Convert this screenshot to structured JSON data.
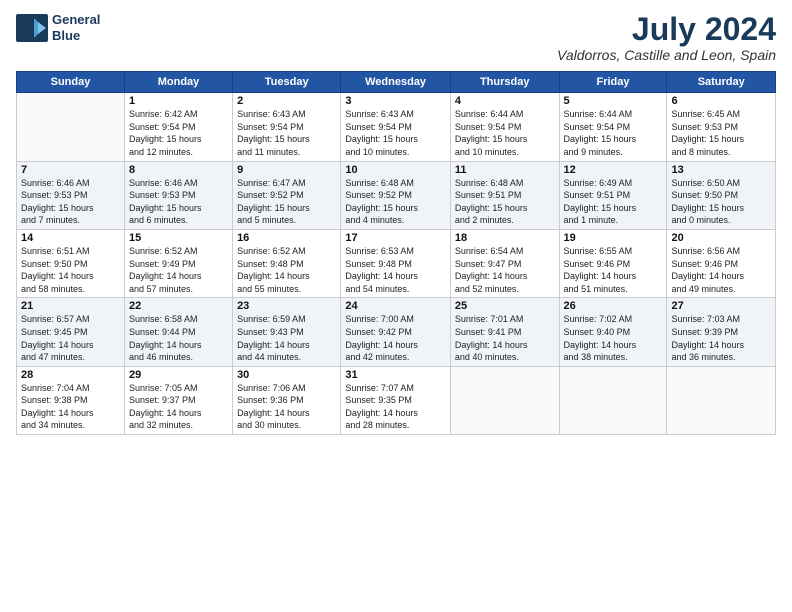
{
  "logo": {
    "line1": "General",
    "line2": "Blue"
  },
  "title": "July 2024",
  "location": "Valdorros, Castille and Leon, Spain",
  "days_of_week": [
    "Sunday",
    "Monday",
    "Tuesday",
    "Wednesday",
    "Thursday",
    "Friday",
    "Saturday"
  ],
  "weeks": [
    [
      {
        "day": "",
        "info": ""
      },
      {
        "day": "1",
        "info": "Sunrise: 6:42 AM\nSunset: 9:54 PM\nDaylight: 15 hours\nand 12 minutes."
      },
      {
        "day": "2",
        "info": "Sunrise: 6:43 AM\nSunset: 9:54 PM\nDaylight: 15 hours\nand 11 minutes."
      },
      {
        "day": "3",
        "info": "Sunrise: 6:43 AM\nSunset: 9:54 PM\nDaylight: 15 hours\nand 10 minutes."
      },
      {
        "day": "4",
        "info": "Sunrise: 6:44 AM\nSunset: 9:54 PM\nDaylight: 15 hours\nand 10 minutes."
      },
      {
        "day": "5",
        "info": "Sunrise: 6:44 AM\nSunset: 9:54 PM\nDaylight: 15 hours\nand 9 minutes."
      },
      {
        "day": "6",
        "info": "Sunrise: 6:45 AM\nSunset: 9:53 PM\nDaylight: 15 hours\nand 8 minutes."
      }
    ],
    [
      {
        "day": "7",
        "info": "Sunrise: 6:46 AM\nSunset: 9:53 PM\nDaylight: 15 hours\nand 7 minutes."
      },
      {
        "day": "8",
        "info": "Sunrise: 6:46 AM\nSunset: 9:53 PM\nDaylight: 15 hours\nand 6 minutes."
      },
      {
        "day": "9",
        "info": "Sunrise: 6:47 AM\nSunset: 9:52 PM\nDaylight: 15 hours\nand 5 minutes."
      },
      {
        "day": "10",
        "info": "Sunrise: 6:48 AM\nSunset: 9:52 PM\nDaylight: 15 hours\nand 4 minutes."
      },
      {
        "day": "11",
        "info": "Sunrise: 6:48 AM\nSunset: 9:51 PM\nDaylight: 15 hours\nand 2 minutes."
      },
      {
        "day": "12",
        "info": "Sunrise: 6:49 AM\nSunset: 9:51 PM\nDaylight: 15 hours\nand 1 minute."
      },
      {
        "day": "13",
        "info": "Sunrise: 6:50 AM\nSunset: 9:50 PM\nDaylight: 15 hours\nand 0 minutes."
      }
    ],
    [
      {
        "day": "14",
        "info": "Sunrise: 6:51 AM\nSunset: 9:50 PM\nDaylight: 14 hours\nand 58 minutes."
      },
      {
        "day": "15",
        "info": "Sunrise: 6:52 AM\nSunset: 9:49 PM\nDaylight: 14 hours\nand 57 minutes."
      },
      {
        "day": "16",
        "info": "Sunrise: 6:52 AM\nSunset: 9:48 PM\nDaylight: 14 hours\nand 55 minutes."
      },
      {
        "day": "17",
        "info": "Sunrise: 6:53 AM\nSunset: 9:48 PM\nDaylight: 14 hours\nand 54 minutes."
      },
      {
        "day": "18",
        "info": "Sunrise: 6:54 AM\nSunset: 9:47 PM\nDaylight: 14 hours\nand 52 minutes."
      },
      {
        "day": "19",
        "info": "Sunrise: 6:55 AM\nSunset: 9:46 PM\nDaylight: 14 hours\nand 51 minutes."
      },
      {
        "day": "20",
        "info": "Sunrise: 6:56 AM\nSunset: 9:46 PM\nDaylight: 14 hours\nand 49 minutes."
      }
    ],
    [
      {
        "day": "21",
        "info": "Sunrise: 6:57 AM\nSunset: 9:45 PM\nDaylight: 14 hours\nand 47 minutes."
      },
      {
        "day": "22",
        "info": "Sunrise: 6:58 AM\nSunset: 9:44 PM\nDaylight: 14 hours\nand 46 minutes."
      },
      {
        "day": "23",
        "info": "Sunrise: 6:59 AM\nSunset: 9:43 PM\nDaylight: 14 hours\nand 44 minutes."
      },
      {
        "day": "24",
        "info": "Sunrise: 7:00 AM\nSunset: 9:42 PM\nDaylight: 14 hours\nand 42 minutes."
      },
      {
        "day": "25",
        "info": "Sunrise: 7:01 AM\nSunset: 9:41 PM\nDaylight: 14 hours\nand 40 minutes."
      },
      {
        "day": "26",
        "info": "Sunrise: 7:02 AM\nSunset: 9:40 PM\nDaylight: 14 hours\nand 38 minutes."
      },
      {
        "day": "27",
        "info": "Sunrise: 7:03 AM\nSunset: 9:39 PM\nDaylight: 14 hours\nand 36 minutes."
      }
    ],
    [
      {
        "day": "28",
        "info": "Sunrise: 7:04 AM\nSunset: 9:38 PM\nDaylight: 14 hours\nand 34 minutes."
      },
      {
        "day": "29",
        "info": "Sunrise: 7:05 AM\nSunset: 9:37 PM\nDaylight: 14 hours\nand 32 minutes."
      },
      {
        "day": "30",
        "info": "Sunrise: 7:06 AM\nSunset: 9:36 PM\nDaylight: 14 hours\nand 30 minutes."
      },
      {
        "day": "31",
        "info": "Sunrise: 7:07 AM\nSunset: 9:35 PM\nDaylight: 14 hours\nand 28 minutes."
      },
      {
        "day": "",
        "info": ""
      },
      {
        "day": "",
        "info": ""
      },
      {
        "day": "",
        "info": ""
      }
    ]
  ]
}
